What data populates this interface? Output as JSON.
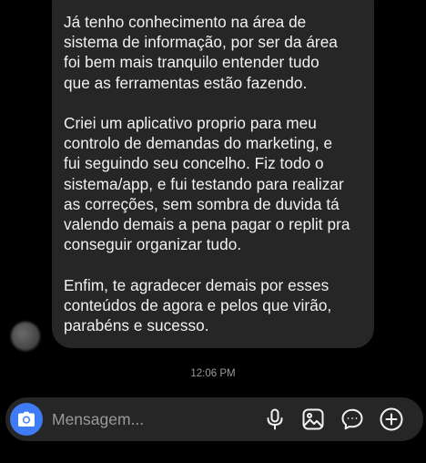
{
  "message": {
    "paragraphs": [
      [
        "Já tenho conhecimento na área de",
        "sistema de informação, por ser da área",
        "foi bem mais tranquilo entender tudo",
        "que as ferramentas estão fazendo."
      ],
      [
        "Criei um aplicativo proprio para meu",
        "controlo de demandas do marketing, e",
        "fui seguindo seu concelho. Fiz todo o",
        "sistema/app, e fui testando para realizar",
        "as correções, sem sombra de duvida tá",
        "valendo demais a pena pagar o replit pra",
        "conseguir organizar tudo."
      ],
      [
        "Enfim, te agradecer demais por esses",
        "conteúdos de agora e pelos que virão,",
        "parabéns e sucesso."
      ]
    ]
  },
  "timestamp": "12:06 PM",
  "composer": {
    "placeholder": "Mensagem...",
    "icons": [
      "camera-icon",
      "microphone-icon",
      "gallery-icon",
      "sticker-icon",
      "plus-icon"
    ],
    "accent_color": "#3d7cf5"
  },
  "colors": {
    "background": "#000000",
    "bubble": "#262626",
    "text": "#f2f2f2",
    "muted": "#9a9a9a"
  }
}
